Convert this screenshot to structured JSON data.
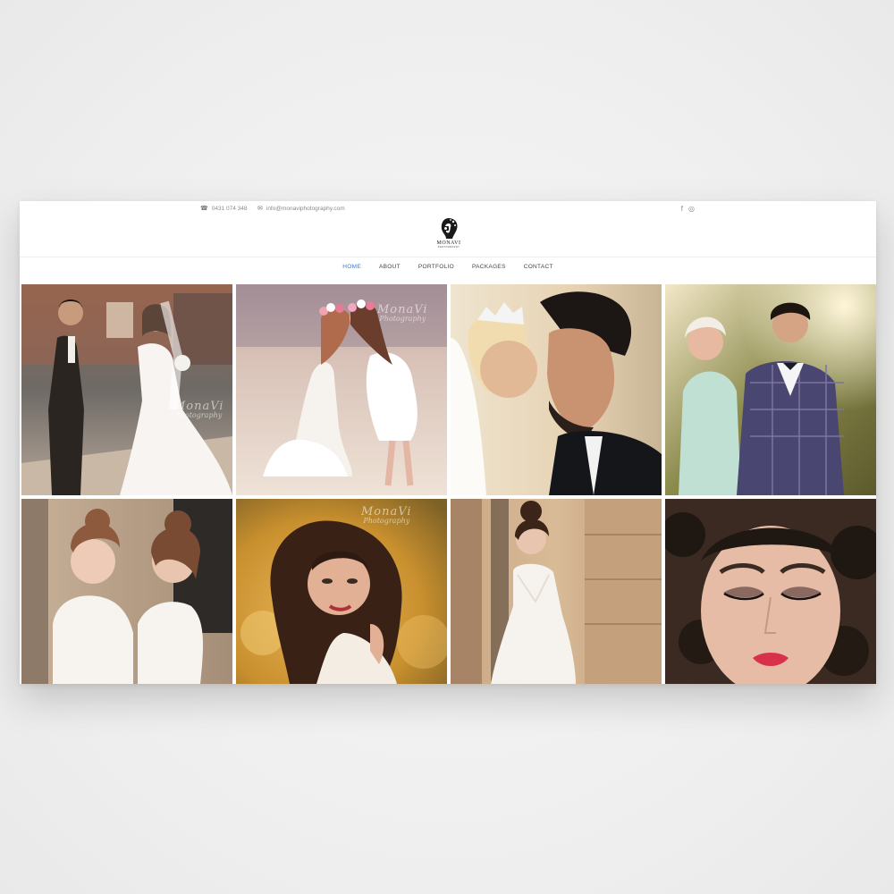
{
  "topbar": {
    "phone": "0431 074 348",
    "email": "info@monaviphotography.com",
    "phone_icon": "phone-icon",
    "email_icon": "envelope-icon",
    "social": [
      {
        "name": "facebook-icon",
        "glyph": "f"
      },
      {
        "name": "instagram-icon",
        "glyph": "◎"
      }
    ]
  },
  "logo": {
    "wordmark": "MONAVI",
    "sub": "PHOTOGRAPHY"
  },
  "nav": {
    "items": [
      "HOME",
      "ABOUT",
      "PORTFOLIO",
      "PACKAGES",
      "CONTACT"
    ],
    "active": "HOME",
    "active_color": "#3a7bc8"
  },
  "gallery": {
    "watermark_line1": "MonaVi",
    "watermark_line2": "Photography",
    "photos": [
      {
        "name": "photo-wedding-couple-walking"
      },
      {
        "name": "photo-girls-flower-crowns"
      },
      {
        "name": "photo-bride-groom-kiss"
      },
      {
        "name": "photo-couple-plaid-suit"
      },
      {
        "name": "photo-two-brides-updo"
      },
      {
        "name": "photo-curly-hair-portrait"
      },
      {
        "name": "photo-bride-white-gown"
      },
      {
        "name": "photo-closeup-makeup"
      }
    ]
  }
}
